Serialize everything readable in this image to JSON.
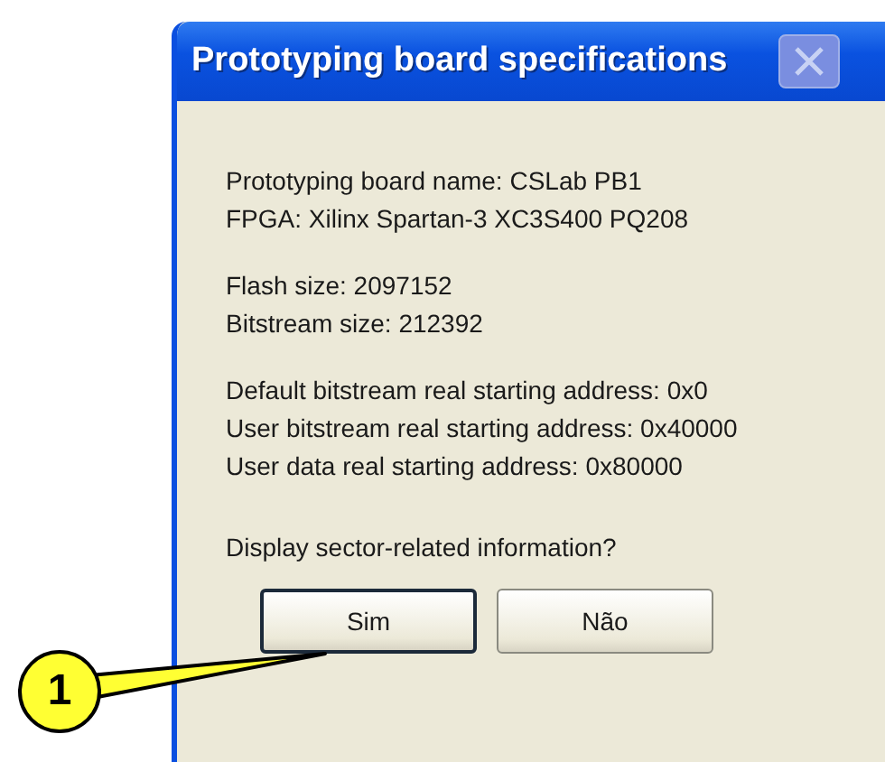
{
  "window": {
    "title": "Prototyping board specifications"
  },
  "groups": [
    [
      "Prototyping board name: CSLab PB1",
      "FPGA: Xilinx Spartan-3 XC3S400 PQ208"
    ],
    [
      "Flash size: 2097152",
      "Bitstream size: 212392"
    ],
    [
      "Default bitstream real starting address: 0x0",
      "User bitstream real starting address: 0x40000",
      "User data real starting address: 0x80000"
    ]
  ],
  "question": "Display sector-related information?",
  "buttons": [
    {
      "label": "Sim",
      "selected": true
    },
    {
      "label": "Não",
      "selected": false
    }
  ],
  "callout": {
    "label": "1"
  }
}
